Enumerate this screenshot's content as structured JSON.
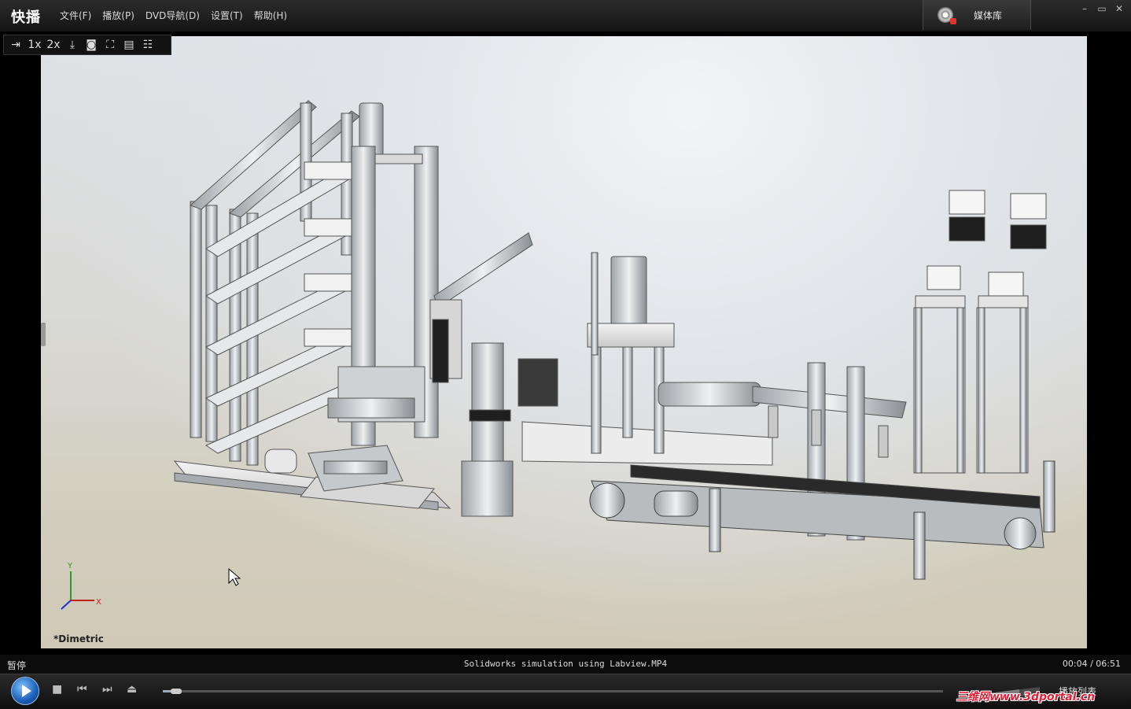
{
  "app": {
    "logo": "快播",
    "menu": [
      {
        "label": "文件(F)"
      },
      {
        "label": "播放(P)"
      },
      {
        "label": "DVD导航(D)"
      },
      {
        "label": "设置(T)"
      },
      {
        "label": "帮助(H)"
      }
    ],
    "media_library": "媒体库",
    "window_buttons": [
      "–",
      "▭",
      "✕"
    ]
  },
  "toolbar": {
    "items": [
      {
        "label": "⇥",
        "icon": "pin-icon"
      },
      {
        "label": "1x",
        "icon": "scale-1x"
      },
      {
        "label": "2x",
        "icon": "scale-2x"
      },
      {
        "label": "⤓",
        "icon": "minimize-to-corner-icon"
      },
      {
        "label": "◙",
        "icon": "camera-icon"
      },
      {
        "label": "⛶",
        "icon": "fullscreen-icon"
      },
      {
        "label": "▤",
        "icon": "color-adjust-icon"
      },
      {
        "label": "☷",
        "icon": "settings-panel-icon"
      }
    ]
  },
  "video": {
    "view_label": "*Dimetric",
    "axes": {
      "x": "X",
      "y": "Y"
    }
  },
  "status": {
    "state": "暂停",
    "filename": "Solidworks simulation using Labview.MP4",
    "time": "00:04 / 06:51"
  },
  "controls": {
    "progress": 0.01,
    "playlist_label": "播放列表",
    "watermark": "三维网www.3dportal.cn"
  }
}
